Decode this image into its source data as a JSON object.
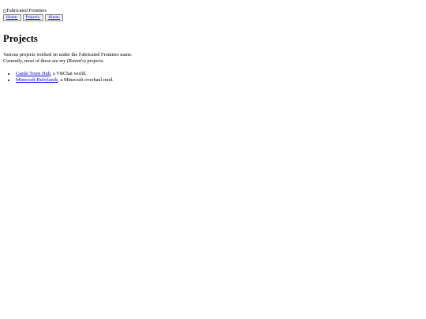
{
  "header": {
    "logo_alt": "Fabricated Frontiers",
    "nav": [
      {
        "label": "Home."
      },
      {
        "label": "Projects."
      },
      {
        "label": "About."
      }
    ]
  },
  "main": {
    "title": "Projects",
    "intro_line1": "Various projects worked on under the Fabricated Frontiers name.",
    "intro_line2": "Currently, most of these are my (Raven's) projects.",
    "projects": [
      {
        "link": "Castle Town Hub",
        "desc": ", a VRChat world."
      },
      {
        "link": "Minecraft Rubylands",
        "desc": ", a Minecraft overhaul mod."
      }
    ]
  },
  "colors": {
    "link": "#0000ee",
    "text": "#000000",
    "background": "#ffffff"
  }
}
